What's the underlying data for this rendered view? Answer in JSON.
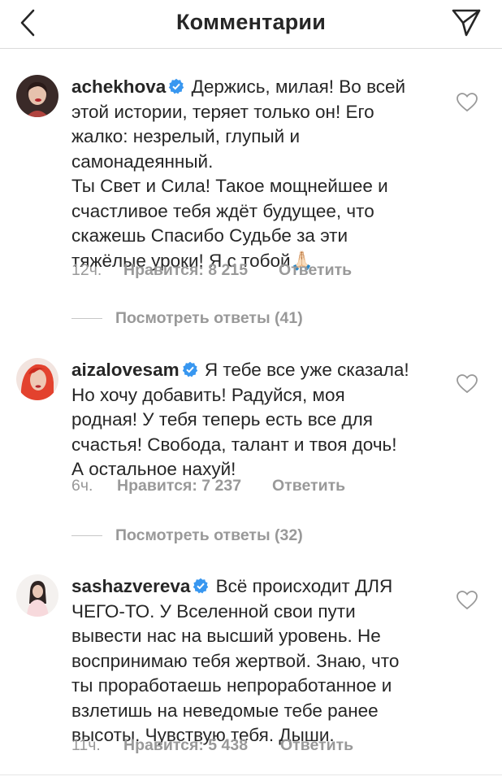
{
  "header": {
    "title": "Комментарии",
    "back_icon": "chevron-left-icon",
    "send_icon": "paper-plane-icon"
  },
  "colors": {
    "verified": "#3897f0",
    "muted": "#999999",
    "text": "#262626"
  },
  "comments": [
    {
      "username": "achekhova",
      "verified": true,
      "lines": [
        "Держись, милая! Во всей",
        "этой истории, теряет только он! Его",
        "жалко: незрелый, глупый и",
        "самонадеянный.",
        "Ты Свет и Сила! Такое мощнейшее и",
        "счастливое тебя ждёт будущее, что",
        "скажешь Спасибо Судьбе за эти",
        "тяжёлые уроки! Я с тобой🙏🏻"
      ],
      "time": "12ч.",
      "likes": "Нравится: 8 215",
      "reply": "Ответить",
      "view_replies": "Посмотреть ответы (41)"
    },
    {
      "username": "aizalovesam",
      "verified": true,
      "lines": [
        "Я тебе все уже сказала!",
        "Но хочу добавить! Радуйся, моя",
        "родная! У тебя теперь есть все для",
        "счастья! Свобода, талант и твоя дочь!",
        "А остальное нахуй!"
      ],
      "time": "6ч.",
      "likes": "Нравится: 7 237",
      "reply": "Ответить",
      "view_replies": "Посмотреть ответы (32)"
    },
    {
      "username": "sashazvereva",
      "verified": true,
      "lines": [
        "Всё происходит ДЛЯ",
        "ЧЕГО-ТО. У Вселенной свои пути",
        "вывести нас на высший уровень. Не",
        "воспринимаю тебя жертвой. Знаю, что",
        "ты проработаешь непроработанное и",
        "взлетишь на неведомые тебе ранее",
        "высоты. Чувствую тебя. Дыши."
      ],
      "time": "11ч.",
      "likes": "Нравится: 5 438",
      "reply": "Ответить"
    }
  ]
}
